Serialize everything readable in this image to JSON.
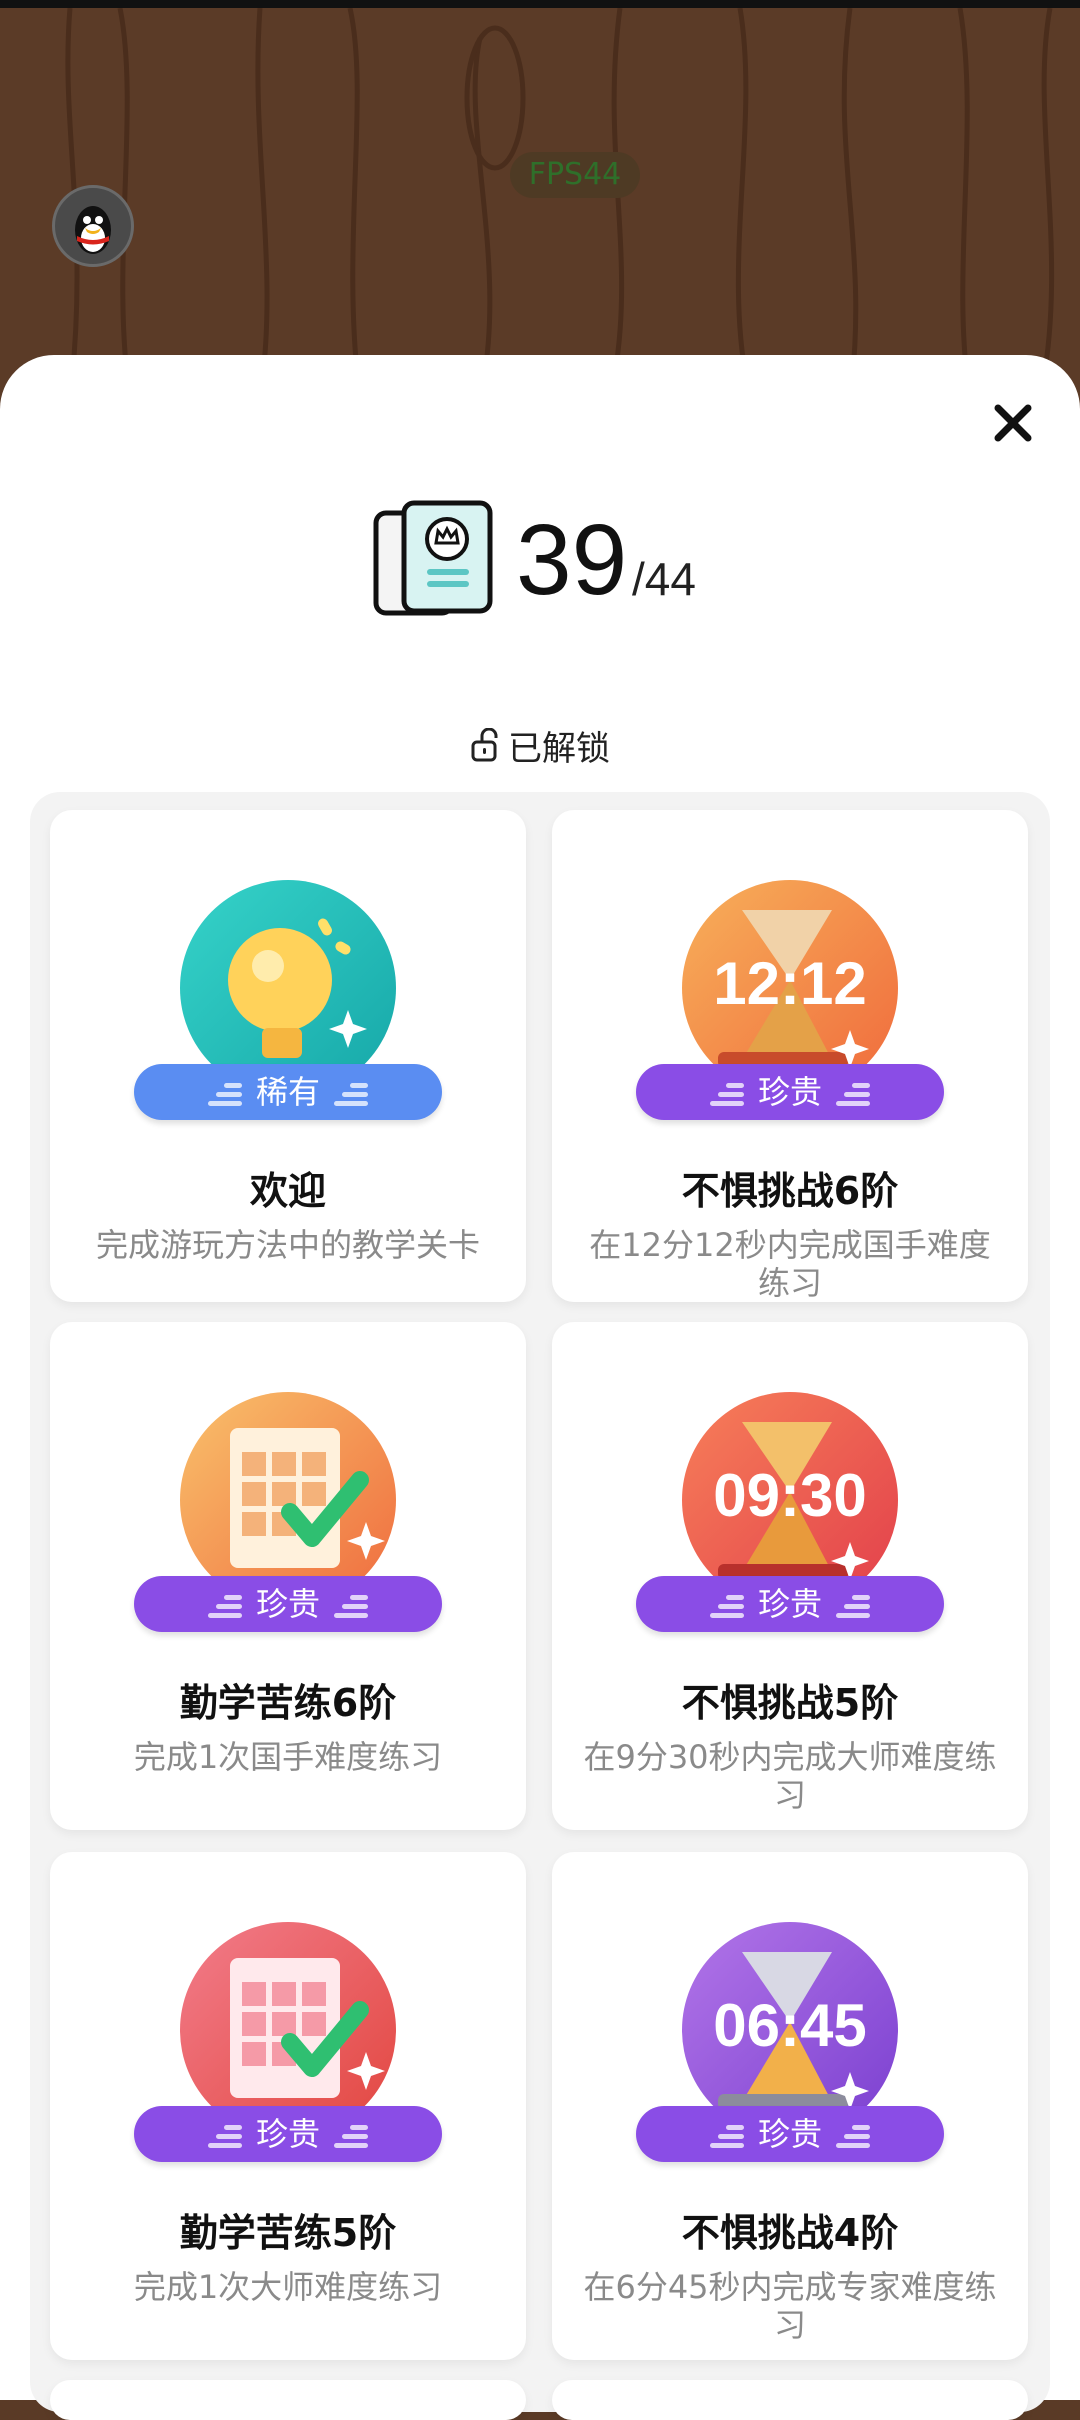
{
  "fps_label": "FPS44",
  "counter": {
    "unlocked": "39",
    "total": "/44"
  },
  "section_label": "已解锁",
  "cards": [
    {
      "tag": "稀有",
      "title": "欢迎",
      "desc": "完成游玩方法中的教学关卡"
    },
    {
      "tag": "珍贵",
      "title": "不惧挑战6阶",
      "desc": "在12分12秒内完成国手难度练习",
      "time": "12:12"
    },
    {
      "tag": "珍贵",
      "title": "勤学苦练6阶",
      "desc": "完成1次国手难度练习"
    },
    {
      "tag": "珍贵",
      "title": "不惧挑战5阶",
      "desc": "在9分30秒内完成大师难度练习",
      "time": "09:30"
    },
    {
      "tag": "珍贵",
      "title": "勤学苦练5阶",
      "desc": "完成1次大师难度练习"
    },
    {
      "tag": "珍贵",
      "title": "不惧挑战4阶",
      "desc": "在6分45秒内完成专家难度练习",
      "time": "06:45"
    }
  ],
  "colors": {
    "rare": "#5a8df2",
    "precious": "#8a4de6"
  },
  "icons": [
    "qq-avatar-icon",
    "close-icon",
    "document-icon",
    "unlock-icon",
    "lightbulb-medal-icon",
    "hourglass-medal-icon",
    "grid-check-medal-icon"
  ]
}
